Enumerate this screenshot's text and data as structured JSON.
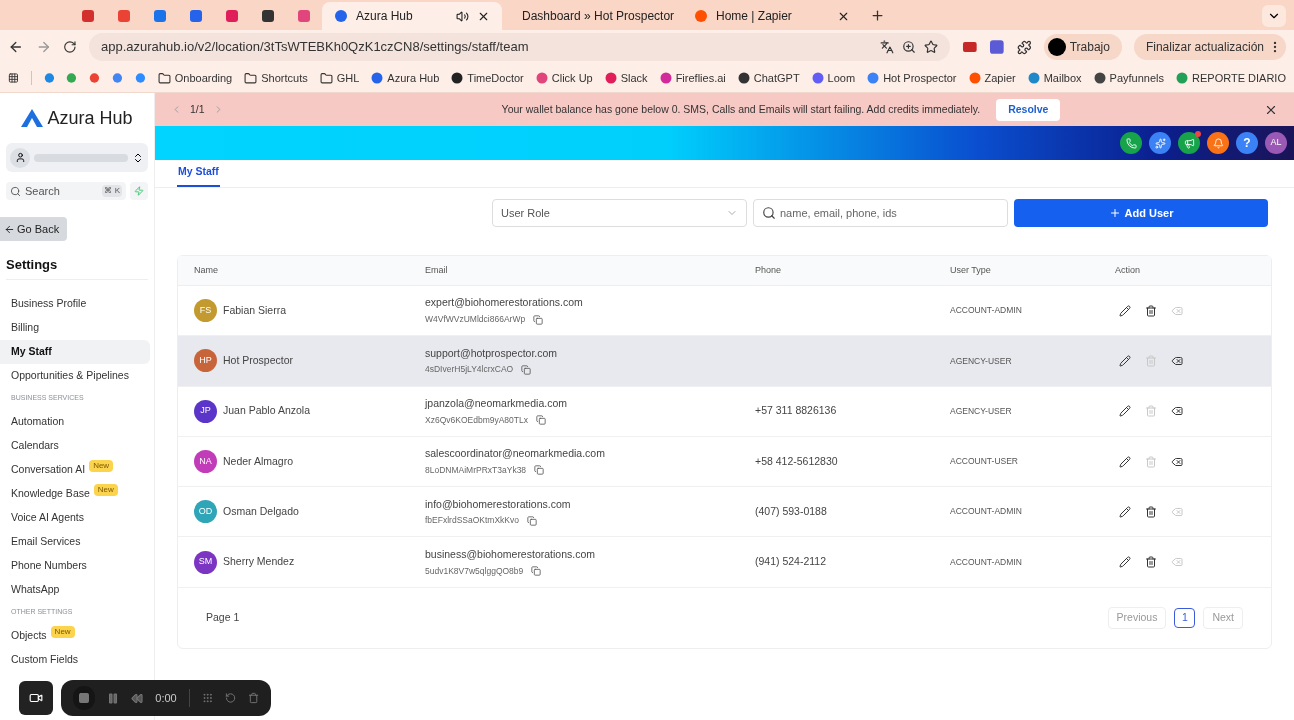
{
  "browser": {
    "tabs": [
      {
        "title": "Azura Hub",
        "selected": true
      },
      {
        "title": "Dashboard » Hot Prospector",
        "selected": false
      },
      {
        "title": "Home | Zapier",
        "selected": false
      }
    ],
    "url": "app.azurahub.io/v2/location/3tTsWTEBKh0QzK1czCN8/settings/staff/team",
    "profile": "Trabajo",
    "update_button": "Finalizar actualización",
    "bookmarks": [
      {
        "label": "Onboarding",
        "kind": "folder"
      },
      {
        "label": "Shortcuts",
        "kind": "folder"
      },
      {
        "label": "GHL",
        "kind": "folder"
      },
      {
        "label": "Azura Hub",
        "kind": "site",
        "color": "#2563eb"
      },
      {
        "label": "TimeDoctor",
        "kind": "site",
        "color": "#222222"
      },
      {
        "label": "Click Up",
        "kind": "site",
        "color": "#e0467c"
      },
      {
        "label": "Slack",
        "kind": "site",
        "color": "#e01e5a"
      },
      {
        "label": "Fireflies.ai",
        "kind": "site",
        "color": "#d22a9a"
      },
      {
        "label": "ChatGPT",
        "kind": "site",
        "color": "#333333"
      },
      {
        "label": "Loom",
        "kind": "site",
        "color": "#625df5"
      },
      {
        "label": "Hot Prospector",
        "kind": "site",
        "color": "#3b82f6"
      },
      {
        "label": "Zapier",
        "kind": "site",
        "color": "#ff4f00"
      },
      {
        "label": "Mailbox",
        "kind": "site",
        "color": "#1e88c9"
      },
      {
        "label": "Payfunnels",
        "kind": "site",
        "color": "#444444"
      },
      {
        "label": "REPORTE DIARIO",
        "kind": "site",
        "color": "#22a055"
      }
    ]
  },
  "sidebar": {
    "logo": "Azura Hub",
    "search": {
      "placeholder": "Search",
      "shortcut": "⌘ K"
    },
    "back": "Go Back",
    "title": "Settings",
    "nav": [
      {
        "kind": "item",
        "label": "Business Profile",
        "selected": false
      },
      {
        "kind": "item",
        "label": "Billing",
        "selected": false
      },
      {
        "kind": "item",
        "label": "My Staff",
        "selected": true
      },
      {
        "kind": "item",
        "label": "Opportunities & Pipelines",
        "selected": false
      },
      {
        "kind": "section",
        "label": "BUSINESS SERVICES"
      },
      {
        "kind": "item",
        "label": "Automation",
        "selected": false
      },
      {
        "kind": "item",
        "label": "Calendars",
        "selected": false
      },
      {
        "kind": "item",
        "label": "Conversation AI",
        "selected": false,
        "badge": "New"
      },
      {
        "kind": "item",
        "label": "Knowledge Base",
        "selected": false,
        "badge": "New"
      },
      {
        "kind": "item",
        "label": "Voice AI Agents",
        "selected": false
      },
      {
        "kind": "item",
        "label": "Email Services",
        "selected": false
      },
      {
        "kind": "item",
        "label": "Phone Numbers",
        "selected": false
      },
      {
        "kind": "item",
        "label": "WhatsApp",
        "selected": false
      },
      {
        "kind": "section",
        "label": "OTHER SETTINGS"
      },
      {
        "kind": "item",
        "label": "Objects",
        "selected": false,
        "badge": "New"
      },
      {
        "kind": "item",
        "label": "Custom Fields",
        "selected": false
      }
    ]
  },
  "banner": {
    "pager": "1/1",
    "message": "Your wallet balance has gone below 0. SMS, Calls and Emails will start failing. Add credits immediately.",
    "action": "Resolve"
  },
  "header": {
    "help": "?",
    "avatar": "AL"
  },
  "page_tabs": [
    {
      "label": "My Staff",
      "selected": true
    }
  ],
  "filters": {
    "role": {
      "placeholder": "User Role"
    },
    "search": {
      "placeholder": "name, email, phone, ids"
    },
    "add_button": "Add User"
  },
  "table": {
    "columns": [
      "Name",
      "Email",
      "Phone",
      "User Type",
      "Action"
    ],
    "rows": [
      {
        "initials": "FS",
        "color": "#c39a2f",
        "name": "Fabian Sierra",
        "email": "expert@biohomerestorations.com",
        "id": "W4VfWVzUMldci866ArWp",
        "phone": "",
        "user_type": "ACCOUNT-ADMIN",
        "selected": false,
        "delete_disabled": false,
        "remove_disabled": true
      },
      {
        "initials": "HP",
        "color": "#c8643a",
        "name": "Hot Prospector",
        "email": "support@hotprospector.com",
        "id": "4sDIverH5jLY4lcrxCAO",
        "phone": "",
        "user_type": "AGENCY-USER",
        "selected": true,
        "delete_disabled": true,
        "remove_disabled": false
      },
      {
        "initials": "JP",
        "color": "#5b35c9",
        "name": "Juan Pablo Anzola",
        "email": "jpanzola@neomarkmedia.com",
        "id": "Xz6Qv6KOEdbm9yA80TLx",
        "phone": "+57 311 8826136",
        "user_type": "AGENCY-USER",
        "selected": false,
        "delete_disabled": true,
        "remove_disabled": false
      },
      {
        "initials": "NA",
        "color": "#c23bb8",
        "name": "Neder Almagro",
        "email": "salescoordinator@neomarkmedia.com",
        "id": "8LoDNMAiMrPRxT3aYk38",
        "phone": "+58 412-5612830",
        "user_type": "ACCOUNT-USER",
        "selected": false,
        "delete_disabled": true,
        "remove_disabled": false
      },
      {
        "initials": "OD",
        "color": "#2fa5b8",
        "name": "Osman Delgado",
        "email": "info@biohomerestorations.com",
        "id": "fbEFxlrdSSaOKtmXkKvo",
        "phone": "(407) 593-0188",
        "user_type": "ACCOUNT-ADMIN",
        "selected": false,
        "delete_disabled": false,
        "remove_disabled": true
      },
      {
        "initials": "SM",
        "color": "#7b35c2",
        "name": "Sherry Mendez",
        "email": "business@biohomerestorations.com",
        "id": "5udv1K8V7w5qlggQO8b9",
        "phone": "(941) 524-2112",
        "user_type": "ACCOUNT-ADMIN",
        "selected": false,
        "delete_disabled": false,
        "remove_disabled": true
      }
    ]
  },
  "pagination": {
    "label": "Page 1",
    "previous": "Previous",
    "pages": [
      {
        "label": "1",
        "selected": true
      }
    ],
    "next": "Next"
  },
  "recorder": {
    "time": "0:00"
  }
}
